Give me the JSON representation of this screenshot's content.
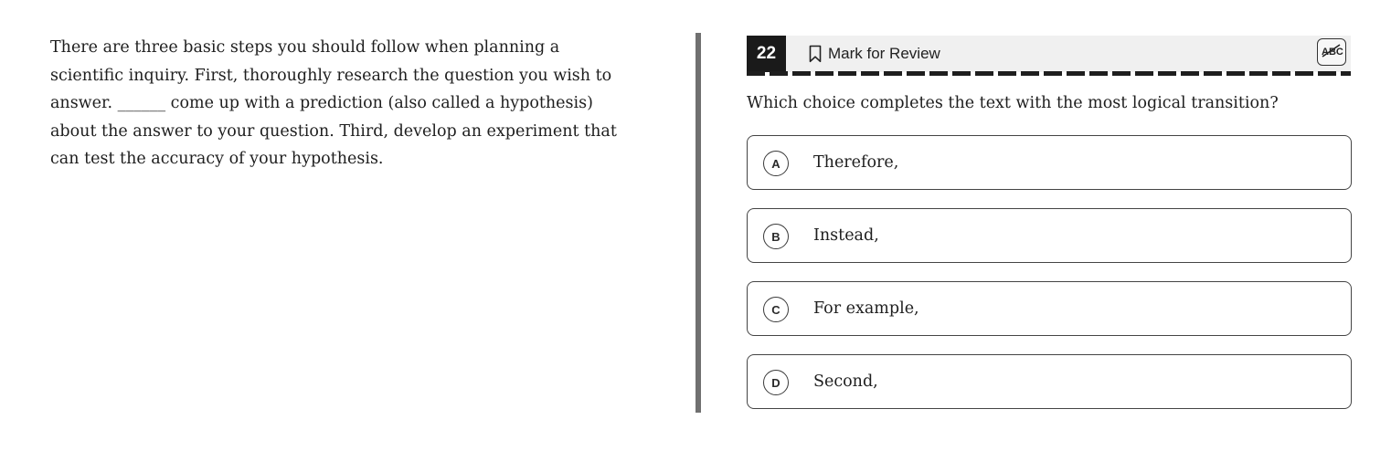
{
  "passage": {
    "text": "There are three basic steps you should follow when planning a scientific inquiry. First, thoroughly research the question you wish to answer. ______ come up with a prediction (also called a hypothesis) about the answer to your question. Third, develop an experiment that can test the accuracy of your hypothesis."
  },
  "header": {
    "question_number": "22",
    "mark_for_review_label": "Mark for Review",
    "bookmark_icon": "bookmark-outline-icon",
    "abc_icon": "abc-strikethrough-icon"
  },
  "question": {
    "prompt": "Which choice completes the text with the most logical transition?"
  },
  "choices": [
    {
      "letter": "A",
      "text": "Therefore,"
    },
    {
      "letter": "B",
      "text": "Instead,"
    },
    {
      "letter": "C",
      "text": "For example,"
    },
    {
      "letter": "D",
      "text": "Second,"
    }
  ]
}
